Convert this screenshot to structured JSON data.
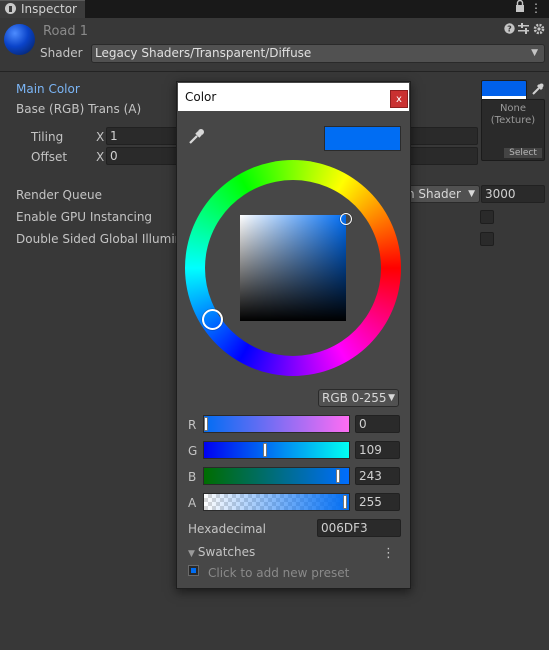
{
  "tab": {
    "label": "Inspector"
  },
  "header": {
    "object_name": "Road 1",
    "shader_label": "Shader",
    "shader_value": "Legacy Shaders/Transparent/Diffuse"
  },
  "properties": {
    "main_color": "Main Color",
    "base_label": "Base (RGB) Trans (A)",
    "tiling_label": "Tiling",
    "offset_label": "Offset",
    "axis_x": "X",
    "tiling_x": "1",
    "offset_x": "0",
    "texture_none": "None\n(Texture)",
    "texture_select": "Select",
    "render_queue": "Render Queue",
    "queue_mode": "n Shader",
    "queue_value": "3000",
    "gpu_instancing": "Enable GPU Instancing",
    "double_sided": "Double Sided Global Illumina"
  },
  "picker": {
    "title": "Color",
    "close": "x",
    "mode": "RGB 0-255",
    "channels": [
      {
        "label": "R",
        "value": "0",
        "fraction": 0.0
      },
      {
        "label": "G",
        "value": "109",
        "fraction": 0.427
      },
      {
        "label": "B",
        "value": "243",
        "fraction": 0.953
      },
      {
        "label": "A",
        "value": "255",
        "fraction": 1.0
      }
    ],
    "hex_label": "Hexadecimal",
    "hex_value": "006DF3",
    "swatches_label": "Swatches",
    "add_preset": "Click to add new preset",
    "menu_glyph": "⋮"
  },
  "colors": {
    "current": "#006df3",
    "accent_label": "#7bb5f5",
    "close_button": "#c93131"
  },
  "icons": [
    "inspector-icon",
    "lock-icon",
    "kebab-menu-icon",
    "help-icon",
    "preset-icon",
    "gear-icon",
    "eyedropper-icon",
    "dropdown-caret-icon",
    "swatch-icon"
  ]
}
